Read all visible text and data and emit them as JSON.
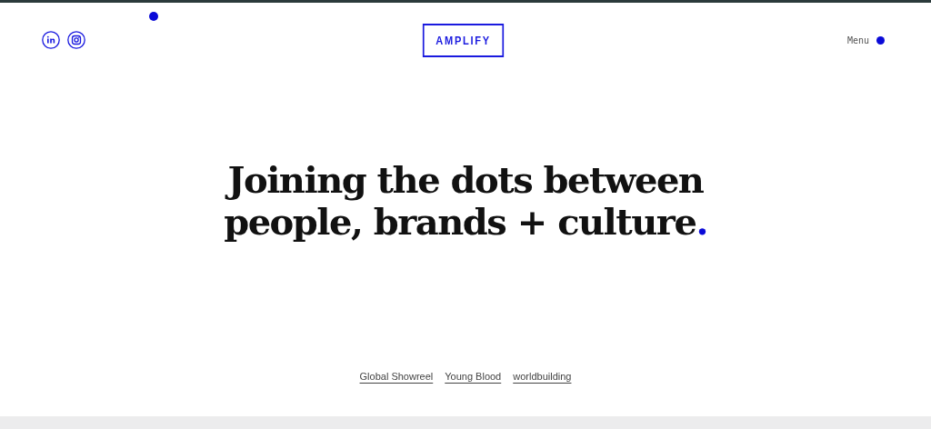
{
  "header": {
    "social": [
      {
        "kind": "linkedin"
      },
      {
        "kind": "instagram"
      }
    ],
    "logo": "AMPLIFY",
    "menu": "Menu"
  },
  "hero": {
    "lines": [
      "Joining the dots between",
      "people, brands + culture"
    ],
    "end_mark": "."
  },
  "links": [
    "Global Showreel",
    "Young Blood",
    "worldbuilding"
  ]
}
